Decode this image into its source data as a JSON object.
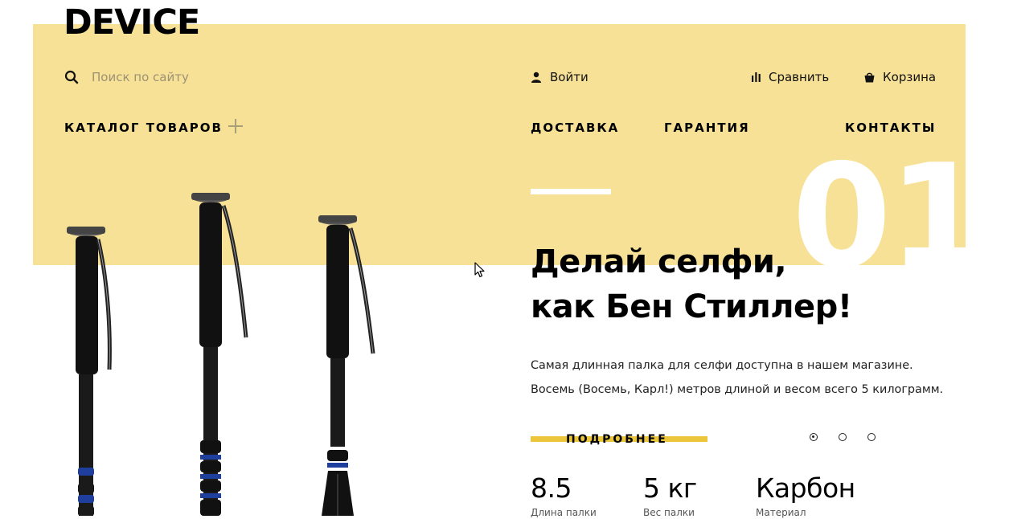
{
  "brand": {
    "logo": "DEVICE"
  },
  "search": {
    "placeholder": "Поиск по сайту"
  },
  "header": {
    "login": "Войти",
    "compare": "Сравнить",
    "cart": "Корзина"
  },
  "nav": {
    "catalog": "КАТАЛОГ ТОВАРОВ",
    "delivery": "ДОСТАВКА",
    "warranty": "ГАРАНТИЯ",
    "contacts": "КОНТАКТЫ"
  },
  "slide": {
    "number": "01",
    "title_line1": "Делай селфи,",
    "title_line2": "как Бен Стиллер!",
    "desc_line1": "Самая длинная палка для селфи доступна в нашем магазине.",
    "desc_line2": "Восемь (Восемь, Карл!) метров длиной и весом всего 5 килограмм.",
    "more": "ПОДРОБНЕЕ",
    "active_index": 1,
    "total": 3
  },
  "stats": [
    {
      "value": "8.5",
      "label": "Длина палки"
    },
    {
      "value": "5 кг",
      "label": "Вес палки"
    },
    {
      "value": "Карбон",
      "label": "Материал"
    }
  ],
  "colors": {
    "band": "#f7e196",
    "accent": "#ecc63a",
    "text": "#000000"
  },
  "icons": [
    "search-icon",
    "user-icon",
    "compare-icon",
    "cart-icon",
    "plus-icon"
  ]
}
